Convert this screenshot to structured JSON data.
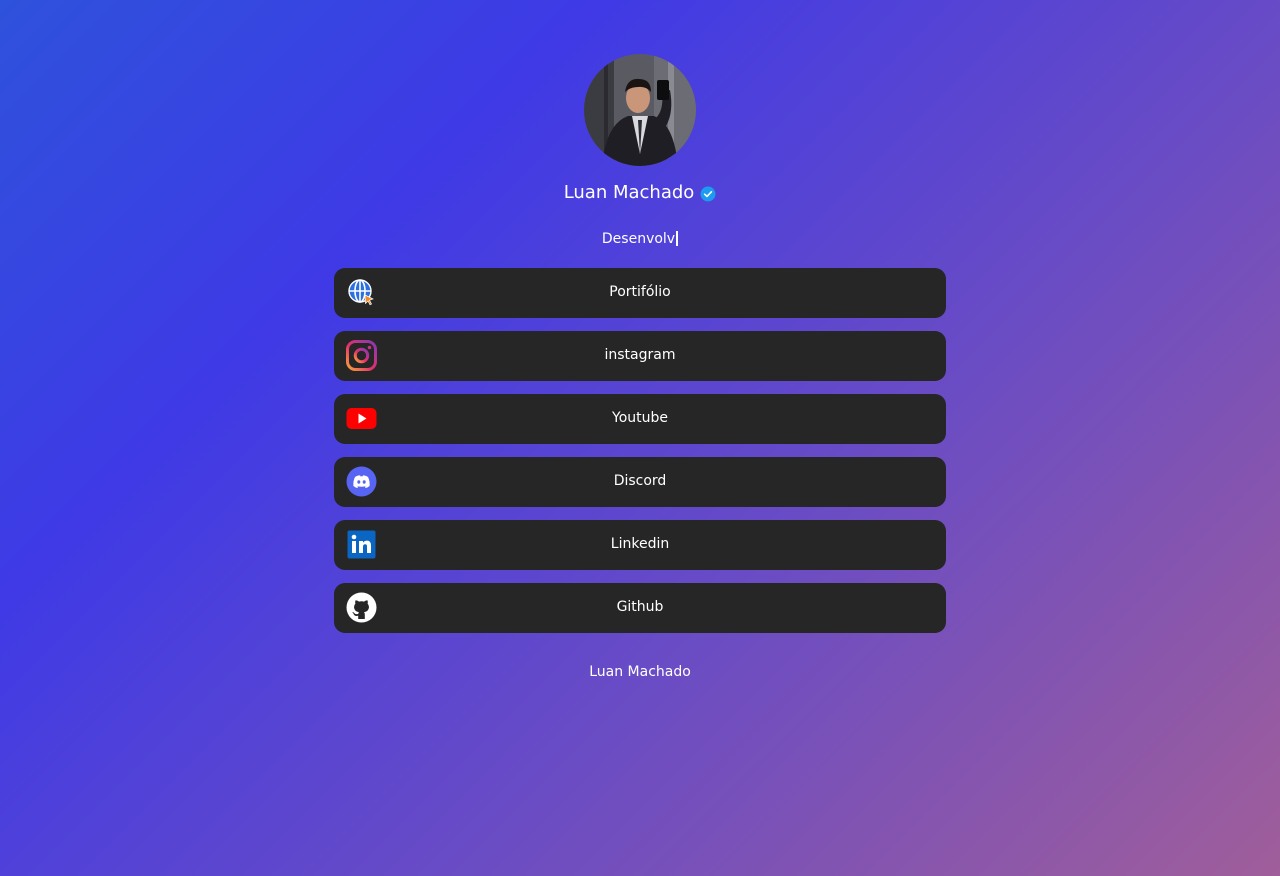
{
  "profile": {
    "name": "Luan Machado",
    "tagline": "Desenvolv",
    "verified_color": "#1d9bf0"
  },
  "links": [
    {
      "label": "Portifólio",
      "icon": "globe-cursor-icon"
    },
    {
      "label": "instagram",
      "icon": "instagram-icon"
    },
    {
      "label": "Youtube",
      "icon": "youtube-icon"
    },
    {
      "label": "Discord",
      "icon": "discord-icon"
    },
    {
      "label": "Linkedin",
      "icon": "linkedin-icon"
    },
    {
      "label": "Github",
      "icon": "github-icon"
    }
  ],
  "footer": {
    "text": "Luan Machado"
  },
  "colors": {
    "card_bg": "#262626",
    "gradient_start": "#2e52dc",
    "gradient_end": "#a05e9a"
  }
}
